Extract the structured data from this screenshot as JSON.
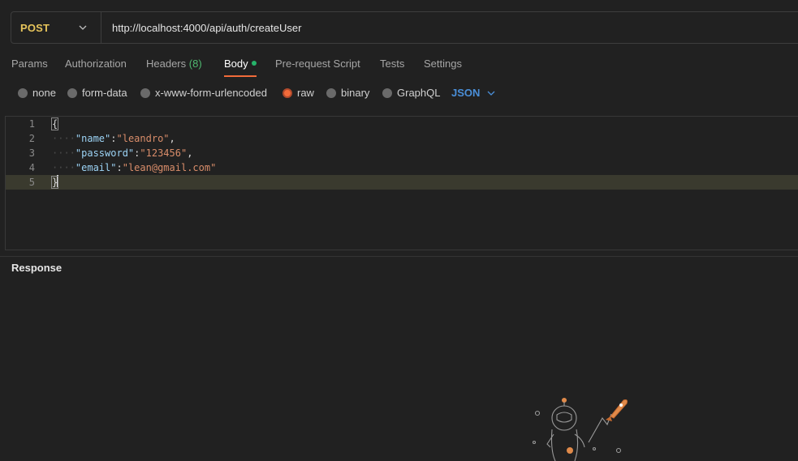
{
  "request": {
    "method": "POST",
    "url": "http://localhost:4000/api/auth/createUser"
  },
  "tabs": [
    {
      "label": "Params"
    },
    {
      "label": "Authorization"
    },
    {
      "label": "Headers",
      "count": "(8)"
    },
    {
      "label": "Body",
      "active": true
    },
    {
      "label": "Pre-request Script"
    },
    {
      "label": "Tests"
    },
    {
      "label": "Settings"
    }
  ],
  "body_types": [
    {
      "label": "none"
    },
    {
      "label": "form-data"
    },
    {
      "label": "x-www-form-urlencoded"
    },
    {
      "label": "raw",
      "selected": true
    },
    {
      "label": "binary"
    },
    {
      "label": "GraphQL"
    }
  ],
  "raw_language": "JSON",
  "editor": {
    "line_numbers": [
      "1",
      "2",
      "3",
      "4",
      "5"
    ],
    "open_brace": "{",
    "close_brace": "}",
    "indent": "····",
    "fields": [
      {
        "key": "\"name\"",
        "value": "\"leandro\"",
        "trailing": ","
      },
      {
        "key": "\"password\"",
        "value": "\"123456\"",
        "trailing": ","
      },
      {
        "key": "\"email\"",
        "value": "\"lean@gmail.com\"",
        "trailing": ""
      }
    ]
  },
  "response": {
    "title": "Response"
  },
  "colors": {
    "method": "#e6c45b",
    "accent": "#f26b3a",
    "language": "#4a8fd9",
    "body_dot": "#26b36a"
  },
  "illustration": "astronaut-launching-rocket"
}
